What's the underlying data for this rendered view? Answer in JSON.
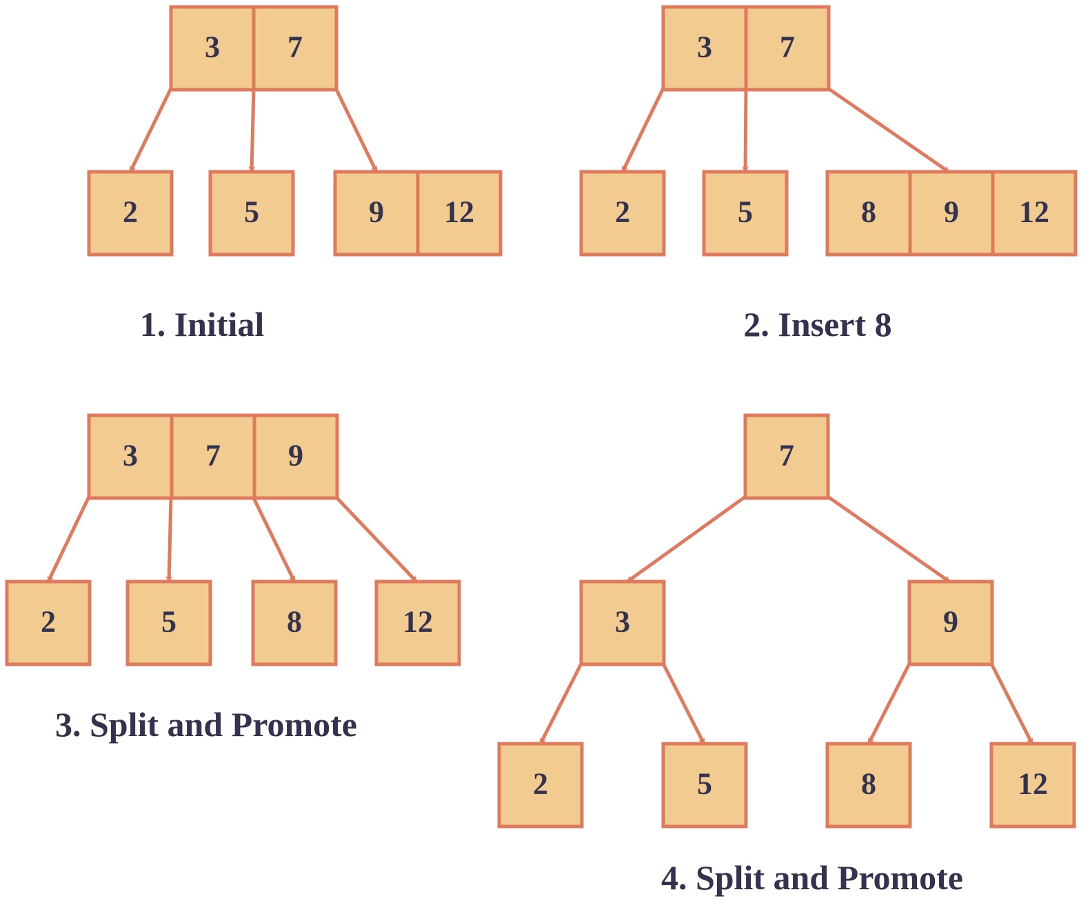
{
  "colors": {
    "node_fill": "#f2cb91",
    "node_border": "#e07a5f",
    "edge": "#e07a5f",
    "text": "#33334f",
    "highlight": "#cc1a12"
  },
  "panels": [
    {
      "caption": "1. Initial",
      "nodes": [
        {
          "id": "root",
          "keys": [
            "3",
            "7"
          ]
        },
        {
          "id": "c0",
          "keys": [
            "2"
          ]
        },
        {
          "id": "c1",
          "keys": [
            "5"
          ]
        },
        {
          "id": "c2",
          "keys": [
            "9",
            "12"
          ]
        }
      ],
      "edges": [
        [
          "root",
          "c0"
        ],
        [
          "root",
          "c1"
        ],
        [
          "root",
          "c2"
        ]
      ]
    },
    {
      "caption": "2. Insert 8",
      "nodes": [
        {
          "id": "root",
          "keys": [
            "3",
            "7"
          ]
        },
        {
          "id": "c0",
          "keys": [
            "2"
          ]
        },
        {
          "id": "c1",
          "keys": [
            "5"
          ]
        },
        {
          "id": "c2",
          "keys": [
            "8",
            "9",
            "12"
          ],
          "highlight_keys": [
            "8"
          ]
        }
      ],
      "edges": [
        [
          "root",
          "c0"
        ],
        [
          "root",
          "c1"
        ],
        [
          "root",
          "c2"
        ]
      ]
    },
    {
      "caption": "3. Split and Promote",
      "nodes": [
        {
          "id": "root",
          "keys": [
            "3",
            "7",
            "9"
          ]
        },
        {
          "id": "c0",
          "keys": [
            "2"
          ]
        },
        {
          "id": "c1",
          "keys": [
            "5"
          ]
        },
        {
          "id": "c2",
          "keys": [
            "8"
          ]
        },
        {
          "id": "c3",
          "keys": [
            "12"
          ]
        }
      ],
      "edges": [
        [
          "root",
          "c0"
        ],
        [
          "root",
          "c1"
        ],
        [
          "root",
          "c2"
        ],
        [
          "root",
          "c3"
        ]
      ]
    },
    {
      "caption": "4. Split and Promote",
      "nodes": [
        {
          "id": "root",
          "keys": [
            "7"
          ]
        },
        {
          "id": "l",
          "keys": [
            "3"
          ]
        },
        {
          "id": "r",
          "keys": [
            "9"
          ]
        },
        {
          "id": "ll",
          "keys": [
            "2"
          ]
        },
        {
          "id": "lr",
          "keys": [
            "5"
          ]
        },
        {
          "id": "rl",
          "keys": [
            "8"
          ]
        },
        {
          "id": "rr",
          "keys": [
            "12"
          ]
        }
      ],
      "edges": [
        [
          "root",
          "l"
        ],
        [
          "root",
          "r"
        ],
        [
          "l",
          "ll"
        ],
        [
          "l",
          "lr"
        ],
        [
          "r",
          "rl"
        ],
        [
          "r",
          "rr"
        ]
      ]
    }
  ]
}
